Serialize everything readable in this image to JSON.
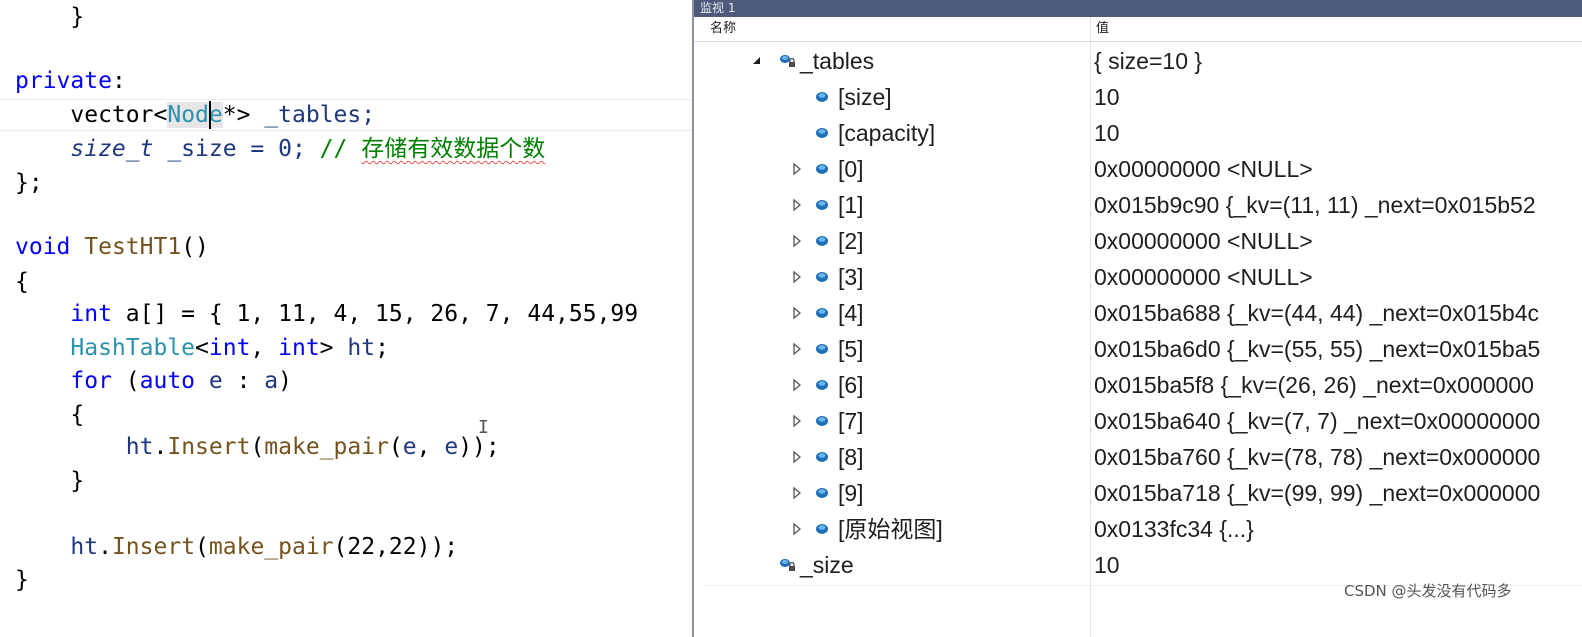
{
  "editor": {
    "lines": {
      "brace_close_1": "}",
      "private_kw": "private",
      "private_colon": ":",
      "vector_kw": "vector",
      "lt": "<",
      "node_type": "Node",
      "ptr_gt": "*>",
      "tables_member": " _tables;",
      "size_t_type": "size_t",
      "size_member": " _size = 0; ",
      "comment_slashes": "// ",
      "comment_text": "存储有效数据个数",
      "class_close": "};",
      "void_kw": "void",
      "func_name": "TestHT1",
      "func_parens": "()",
      "func_open": "{",
      "int_kw": "int",
      "array_decl": " a[] = { 1, 11, 4, 15, 26, 7, 44,55,99",
      "hashtable_type": "HashTable",
      "hashtable_args_open": "<",
      "int_kw2": "int",
      "comma_space": ", ",
      "int_kw3": "int",
      "hashtable_args_close": "> ",
      "ht_var": "ht",
      "semicolon": ";",
      "for_kw": "for",
      "for_open": " (",
      "auto_kw": "auto",
      "for_var_e": " e",
      "for_colon": " : ",
      "for_var_a": "a",
      "for_close": ")",
      "loop_open": "{",
      "ht_call_var": "ht",
      "dot": ".",
      "insert_fn": "Insert",
      "paren_open": "(",
      "make_pair_fn": "make_pair",
      "paren_open2": "(",
      "arg_e1": "e",
      "arg_comma": ", ",
      "arg_e2": "e",
      "call_close": "));",
      "loop_close": "}",
      "ht_call_var2": "ht",
      "dot2": ".",
      "insert_fn2": "Insert",
      "paren_open3": "(",
      "make_pair_fn2": "make_pair",
      "args2": "(22,22));",
      "func_close": "}"
    }
  },
  "watch": {
    "title": "监视 1",
    "col_name": "名称",
    "col_value": "值",
    "rows": [
      {
        "name": "_tables",
        "value": "{ size=10 }",
        "expander": "expanded"
      },
      {
        "name": "[size]",
        "value": "10",
        "expander": "none"
      },
      {
        "name": "[capacity]",
        "value": "10",
        "expander": "none"
      },
      {
        "name": "[0]",
        "value": "0x00000000 <NULL>",
        "expander": "collapsed"
      },
      {
        "name": "[1]",
        "value": "0x015b9c90 {_kv=(11, 11) _next=0x015b52",
        "expander": "collapsed"
      },
      {
        "name": "[2]",
        "value": "0x00000000 <NULL>",
        "expander": "collapsed"
      },
      {
        "name": "[3]",
        "value": "0x00000000 <NULL>",
        "expander": "collapsed"
      },
      {
        "name": "[4]",
        "value": "0x015ba688 {_kv=(44, 44) _next=0x015b4c",
        "expander": "collapsed"
      },
      {
        "name": "[5]",
        "value": "0x015ba6d0 {_kv=(55, 55) _next=0x015ba5",
        "expander": "collapsed"
      },
      {
        "name": "[6]",
        "value": "0x015ba5f8 {_kv=(26, 26) _next=0x000000",
        "expander": "collapsed"
      },
      {
        "name": "[7]",
        "value": "0x015ba640 {_kv=(7, 7) _next=0x00000000",
        "expander": "collapsed"
      },
      {
        "name": "[8]",
        "value": "0x015ba760 {_kv=(78, 78) _next=0x000000",
        "expander": "collapsed"
      },
      {
        "name": "[9]",
        "value": "0x015ba718 {_kv=(99, 99) _next=0x000000",
        "expander": "collapsed"
      },
      {
        "name": "[原始视图]",
        "value": "0x0133fc34 {...}",
        "expander": "collapsed"
      },
      {
        "name": "_size",
        "value": "10",
        "expander": "none"
      }
    ],
    "watermark": "CSDN @头发没有代码多"
  },
  "colors": {
    "keyword": "#0000ff",
    "type": "#2b91af",
    "function": "#74531f",
    "comment": "#008000",
    "watch_title_bg": "#4d5a7c"
  },
  "icons": {
    "member_protected": "field-lock-icon",
    "field": "field-icon",
    "expand_collapsed": "triangle-right-icon",
    "expand_expanded": "triangle-down-icon"
  }
}
